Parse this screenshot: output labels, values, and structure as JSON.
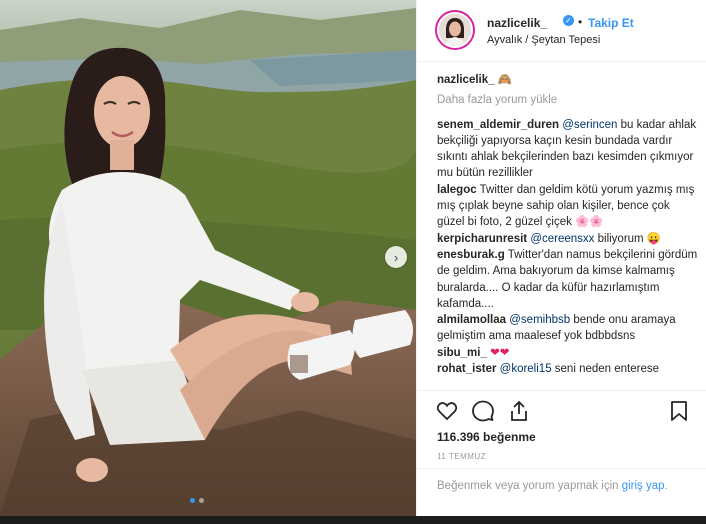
{
  "header": {
    "username": "nazlicelik_",
    "verified_icon": "verified-badge-icon",
    "separator": "•",
    "follow_label": "Takip Et",
    "location": "Ayvalık / Şeytan Tepesi"
  },
  "caption": {
    "username": "nazlicelik_",
    "emoji": "🙈"
  },
  "load_more": "Daha fazla yorum yükle",
  "comments": [
    {
      "user": "senem_aldemir_duren",
      "mention": "@serincen",
      "text": " bu kadar ahlak bekçiliği yapıyorsa kaçın kesin bundada vardır sıkıntı ahlak bekçilerinden bazı kesimden çıkmıyor mu bütün rezillikler"
    },
    {
      "user": "lalegoc",
      "mention": "",
      "text": " Twitter dan geldim kötü yorum yazmış mış mış çıplak beyne sahip olan kişiler, bence çok güzel bi foto, 2 güzel çiçek",
      "emoji": "🌸🌸"
    },
    {
      "user": "kerpicharunresit",
      "mention": "@cereensxx",
      "text": " biliyorum",
      "emoji": "😛"
    },
    {
      "user": "enesburak.g",
      "mention": "",
      "text": " Twitter'dan namus bekçilerini gördüm de geldim. Ama bakıyorum da kimse kalmamış buralarda.... O kadar da küfür hazırlamıştım kafamda...."
    },
    {
      "user": "almilamollaa",
      "mention": "@semihbsb",
      "text": " bende onu aramaya gelmiştim ama maalesef yok bdbbdsns"
    },
    {
      "user": "sibu_mi_",
      "mention": "",
      "text": " ",
      "emoji": "❤❤"
    },
    {
      "user": "rohat_ister",
      "mention": "@koreli15",
      "text": " seni neden enterese"
    }
  ],
  "actions": {
    "like_icon": "heart-icon",
    "comment_icon": "comment-icon",
    "share_icon": "share-icon",
    "save_icon": "bookmark-icon"
  },
  "likes": "116.396 beğenme",
  "date": "11 TEMMUZ",
  "login": {
    "prefix": "Beğenmek veya yorum yapmak için ",
    "link": "giriş yap",
    "suffix": "."
  },
  "photo": {
    "next_icon": "chevron-right-icon",
    "carousel_total": 2,
    "carousel_active": 1
  },
  "colors": {
    "accent": "#3897f0",
    "text": "#262626",
    "muted": "#999999",
    "mention": "#003569"
  }
}
